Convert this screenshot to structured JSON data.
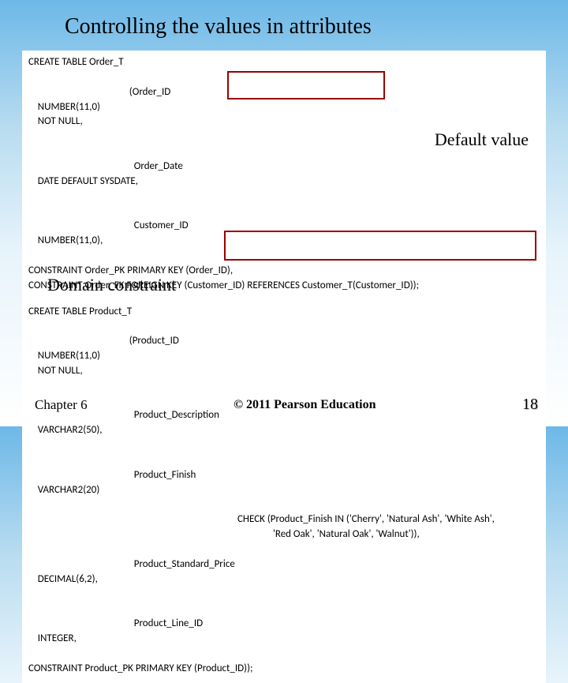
{
  "title": "Controlling the values in attributes",
  "annotations": {
    "default_value": "Default value",
    "domain_constraint": "Domain constraint"
  },
  "sql1": {
    "create": "CREATE TABLE Order_T",
    "open": "(Order_ID",
    "open_type": "NUMBER(11,0)",
    "open_null": "NOT NULL,",
    "l2_name": "Order_Date",
    "l2_type": "DATE DEFAULT SYSDATE,",
    "l3_name": "Customer_ID",
    "l3_type": "NUMBER(11,0),",
    "pk": "CONSTRAINT Order_PK PRIMARY KEY (Order_ID),",
    "fk": "CONSTRAINT Order_FK FOREIGN KEY (Customer_ID) REFERENCES Customer_T(Customer_ID));"
  },
  "sql2": {
    "create": "CREATE TABLE Product_T",
    "open": "(Product_ID",
    "open_type": "NUMBER(11,0)",
    "open_null": "NOT NULL,",
    "l2_name": "Product_Description",
    "l2_type": "VARCHAR2(50),",
    "l3_name": "Product_Finish",
    "l3_type": "VARCHAR2(20)",
    "check1": "CHECK (Product_Finish IN ('Cherry', 'Natural Ash', 'White Ash',",
    "check2": "'Red Oak', 'Natural Oak', 'Walnut')),",
    "l5_name": "Product_Standard_Price",
    "l5_type": "DECIMAL(6,2),",
    "l6_name": "Product_Line_ID",
    "l6_type": "INTEGER,",
    "pk": "CONSTRAINT Product_PK PRIMARY KEY (Product_ID));"
  },
  "footer": {
    "chapter": "Chapter 6",
    "copyright": "© 2011 Pearson Education",
    "slide_no": "18"
  }
}
